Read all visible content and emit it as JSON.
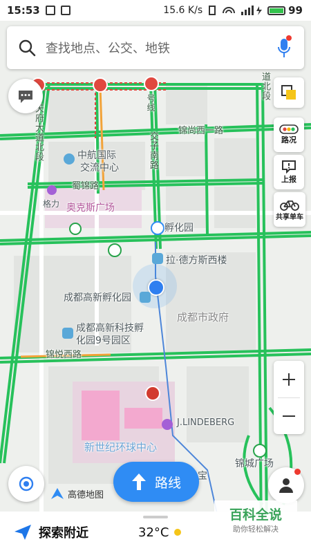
{
  "status_bar": {
    "time": "15:53",
    "net_speed": "15.6 K/s",
    "battery": "99"
  },
  "search": {
    "placeholder": "查找地点、公交、地铁"
  },
  "side_buttons": {
    "traffic": "路况",
    "report": "上报",
    "bike": "共享单车"
  },
  "map": {
    "pois": [
      "中航国际",
      "交流中心",
      "奥克斯广场",
      "格力",
      "孵化园",
      "拉·德方斯西楼",
      "成都高新孵化园",
      "成都市政府",
      "成都高新科技孵",
      "化园9号园区",
      "J.LINDEBERG",
      "新世纪环球中心",
      "锦城广场",
      "宝"
    ],
    "roads": {
      "jinshang_west_1": "锦尚西一路",
      "shujin": "蜀锦路",
      "jinyue_west": "锦悦西路",
      "jiaozi_south": "交子南路",
      "tianfu_ave_north": "天府大道北段",
      "daoben_north": "道北段",
      "hao_xian": "号线"
    }
  },
  "logo": "高德地图",
  "route_button": "路线",
  "bottom": {
    "explore": "探索附近",
    "temperature": "32°C",
    "watermark_title": "百科全说",
    "watermark_sub": "助你轻松解决"
  },
  "colors": {
    "road_green": "#27c15b",
    "accent_blue": "#2f8cf4",
    "map_bg": "#eef0ed",
    "block": "#e2e4e1",
    "mall_pink": "#f3a9cf"
  }
}
